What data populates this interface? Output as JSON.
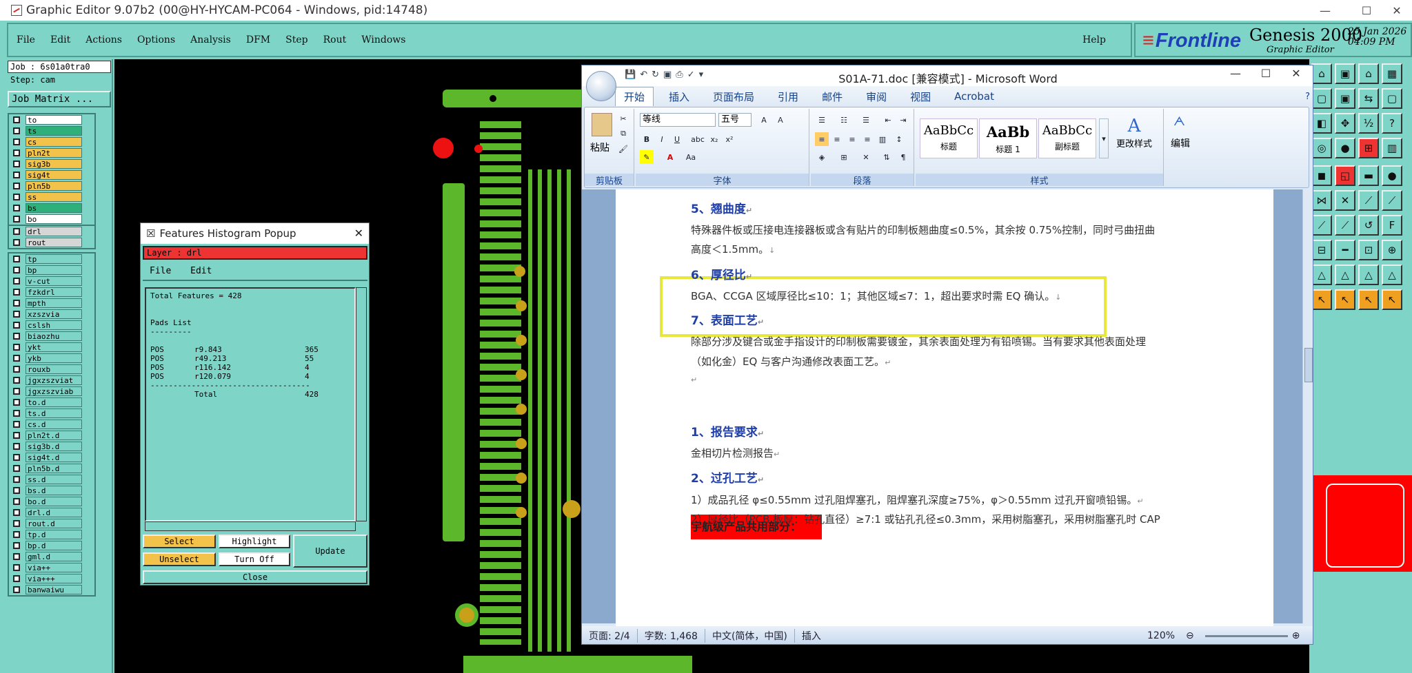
{
  "genesis": {
    "title": "Graphic Editor 9.07b2 (00@HY-HYCAM-PC064 - Windows, pid:14748)",
    "menu": [
      "File",
      "Edit",
      "Actions",
      "Options",
      "Analysis",
      "DFM",
      "Step",
      "Rout",
      "Windows"
    ],
    "help": "Help",
    "brand": {
      "logo": "Frontline",
      "product": "Genesis 2000",
      "sub": "Graphic Editor",
      "date": "25 Jan 2026",
      "time": "04:09 PM"
    },
    "job": "Job : 6s01a0tra0",
    "step": "Step: cam",
    "job_matrix": "Job Matrix ...",
    "layers_board": [
      {
        "name": "to",
        "color": "#ffffff"
      },
      {
        "name": "ts",
        "color": "#2fb07a"
      },
      {
        "name": "cs",
        "color": "#f2c24a"
      },
      {
        "name": "pln2t",
        "color": "#f2c24a"
      },
      {
        "name": "sig3b",
        "color": "#f2c24a"
      },
      {
        "name": "sig4t",
        "color": "#f2c24a"
      },
      {
        "name": "pln5b",
        "color": "#f2c24a"
      },
      {
        "name": "ss",
        "color": "#f2c24a"
      },
      {
        "name": "bs",
        "color": "#2fb07a"
      },
      {
        "name": "bo",
        "color": "#ffffff"
      }
    ],
    "layers_drill": [
      {
        "name": "drl",
        "color": "#d6d6d6"
      },
      {
        "name": "rout",
        "color": "#d6d6d6"
      }
    ],
    "layers_misc": [
      "tp",
      "bp",
      "v-cut",
      "fzkdrl",
      "mpth",
      "xzszvia",
      "cslsh",
      "biaozhu",
      "ykt",
      "ykb",
      "rouxb",
      "jgxzszviat",
      "jgxzszviab",
      "to.d",
      "ts.d",
      "cs.d",
      "pln2t.d",
      "sig3b.d",
      "sig4t.d",
      "pln5b.d",
      "ss.d",
      "bs.d",
      "bo.d",
      "drl.d",
      "rout.d",
      "tp.d",
      "bp.d",
      "gml.d",
      "via++",
      "via+++",
      "banwaiwu"
    ]
  },
  "histogram": {
    "title": "Features Histogram Popup",
    "layer": "Layer :  drl",
    "menu": [
      "File",
      "Edit"
    ],
    "total_features": "Total Features = 428",
    "pads_list": "Pads List",
    "pads_sep": "---------",
    "pads": [
      {
        "type": "POS",
        "symbol": "r9.843",
        "count": "365"
      },
      {
        "type": "POS",
        "symbol": "r49.213",
        "count": "55"
      },
      {
        "type": "POS",
        "symbol": "r116.142",
        "count": "4"
      },
      {
        "type": "POS",
        "symbol": "r120.079",
        "count": "4"
      }
    ],
    "rule": "-----------------------------------",
    "total_label": "Total",
    "total": "428",
    "buttons": {
      "select": "Select",
      "highlight": "Highlight",
      "update": "Update",
      "unselect": "Unselect",
      "turn_off": "Turn Off",
      "close": "Close"
    }
  },
  "word": {
    "title": "S01A-71.doc [兼容模式] - Microsoft Word",
    "tabs": [
      "开始",
      "插入",
      "页面布局",
      "引用",
      "邮件",
      "审阅",
      "视图",
      "Acrobat"
    ],
    "ribbon": {
      "paste": "粘贴",
      "clipboard": "剪贴板",
      "font_name": "等线",
      "font_size": "五号",
      "font_group": "字体",
      "para_group": "段落",
      "styles_group": "样式",
      "styles": [
        {
          "sample": "AaBbCc",
          "name": "标题"
        },
        {
          "sample": "AaBb",
          "name": "标题 1"
        },
        {
          "sample": "AaBbCc",
          "name": "副标题"
        }
      ],
      "change_styles": "更改样式",
      "edit": "编辑"
    },
    "doc": {
      "h5": "5、翘曲度",
      "p5a": "特殊器件板或压接电连接器板或含有贴片的印制板翘曲度≤0.5%，其余按 0.75%控制，同时弓曲扭曲",
      "p5b": "高度＜1.5mm。",
      "h6": "6、厚径比",
      "p6": "BGA、CCGA 区域厚径比≤10：1；其他区域≤7：1，超出要求时需 EQ 确认。",
      "h7": "7、表面工艺",
      "p7a": "除部分涉及键合或金手指设计的印制板需要镀金，其余表面处理为有铅喷锡。当有要求其他表面处理",
      "p7b": "（如化金）EQ 与客户沟通修改表面工艺。",
      "red": "宇航级产品共用部分：",
      "h1": "1、报告要求",
      "p1": "金相切片检测报告",
      "h2": "2、过孔工艺",
      "p2a": "1）成品孔径 φ≤0.55mm 过孔阻焊塞孔，阻焊塞孔深度≥75%，φ＞0.55mm 过孔开窗喷铅锡。",
      "p2b": "2）厚径比（PCB 板厚：钻孔直径）≥7:1 或钻孔孔径≤0.3mm，采用树脂塞孔，采用树脂塞孔时 CAP"
    },
    "status": {
      "page": "页面: 2/4",
      "words": "字数: 1,468",
      "lang": "中文(简体，中国)",
      "mode": "插入",
      "zoom": "120%"
    }
  }
}
